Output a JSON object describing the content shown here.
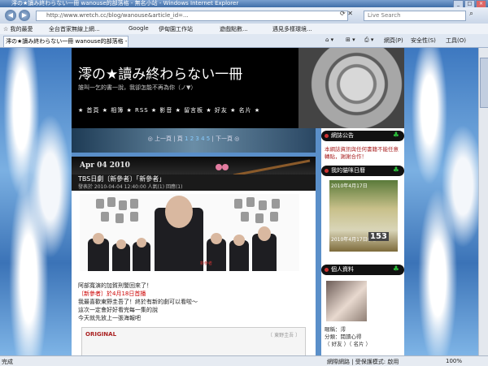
{
  "browser": {
    "window_title": "澪の★讀み終わらない一冊 wanouse的部落格 - 無名小站 - Windows Internet Explorer",
    "address": "http://www.wretch.cc/blog/wanouse&article_id=...",
    "search_placeholder": "Live Search",
    "favorites_label": "我的最愛",
    "favorites_items": [
      "全台首家無線上網...",
      "Google",
      "伊甸園工作站",
      "遊戲點數...",
      "遇見多樣環境..."
    ],
    "tab_label": "澪の★讀み終わらない一冊 wanouse的部落格 - 無...",
    "tools": [
      "網頁(P)",
      "安全性(S)",
      "工具(O)"
    ],
    "status_left": "完成",
    "status_zone": "網際網路 | 受保護模式: 啟用",
    "zoom": "100%"
  },
  "blog": {
    "title": "澪の★讀み終わらない一冊",
    "subtitle": "誰叫一乞的書一說，我卻怎能不再為你（ノ▼）",
    "nav": "★ 首頁 ★ 相簿 ★ RSS ★ 影音 ★ 留言板 ★ 好友 ★ 名片 ★"
  },
  "pager": {
    "prefix": "◎ 上一頁 | 頁",
    "pages": "1 2 3 4 5",
    "suffix": "| 下一頁 ◎"
  },
  "post": {
    "date": "Apr 04 2010",
    "title": "TBS日劇〔新參者〕「新參者」",
    "meta": "發表於 2010-04-04 12:40:00  人氣(1)  回應(1)",
    "poster_label": "新參者",
    "lines": [
      "阿部寬演的加賀刑警回來了！",
      "〔新參者〕於4月18日首播",
      "我最喜歡東野圭吾了！終於有新的劇可以看啦～",
      "這次一定會好好看完每一集的說",
      "今天就先放上一張海報吧"
    ],
    "original_label": "ORIGINAL",
    "original_sub": "〔 東野圭吾 〕"
  },
  "sidebar": {
    "announce_head": "網誌公告",
    "announce_text": "本網誌資訊與任何書籍不能任意轉貼，謝謝合作！",
    "calendar_head": "我的貓咪日曆",
    "calendar_label": "2010年4月17日",
    "calendar_date": "2010年4月17日(六)",
    "calendar_num": "153",
    "profile_head": "個人資料",
    "profile_lines": [
      "暱稱：澪",
      "分類：閱讀心得",
      "（ 好友 ）（ 名片 ）"
    ]
  },
  "colors": {
    "header_bg": "#000000",
    "accent_red": "#cc0000",
    "clover": "#2bbf3a"
  }
}
